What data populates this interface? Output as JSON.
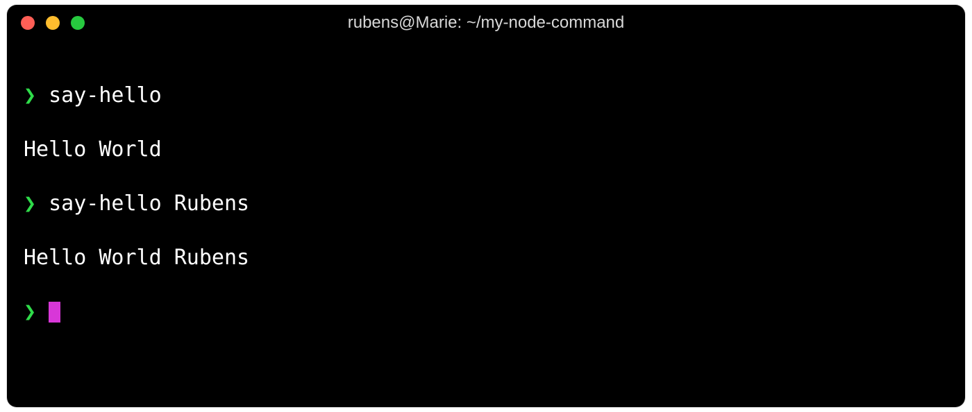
{
  "window": {
    "title": "rubens@Marie: ~/my-node-command"
  },
  "prompt": {
    "char": "❯"
  },
  "lines": {
    "cmd1": "say-hello",
    "out1": "Hello World",
    "cmd2": "say-hello Rubens",
    "out2": "Hello World Rubens"
  },
  "colors": {
    "prompt": "#2fdc4a",
    "cursor": "#d837d8",
    "close": "#ff5f56",
    "minimize": "#ffbd2e",
    "maximize": "#27c93f",
    "background": "#000000",
    "text": "#ffffff"
  }
}
